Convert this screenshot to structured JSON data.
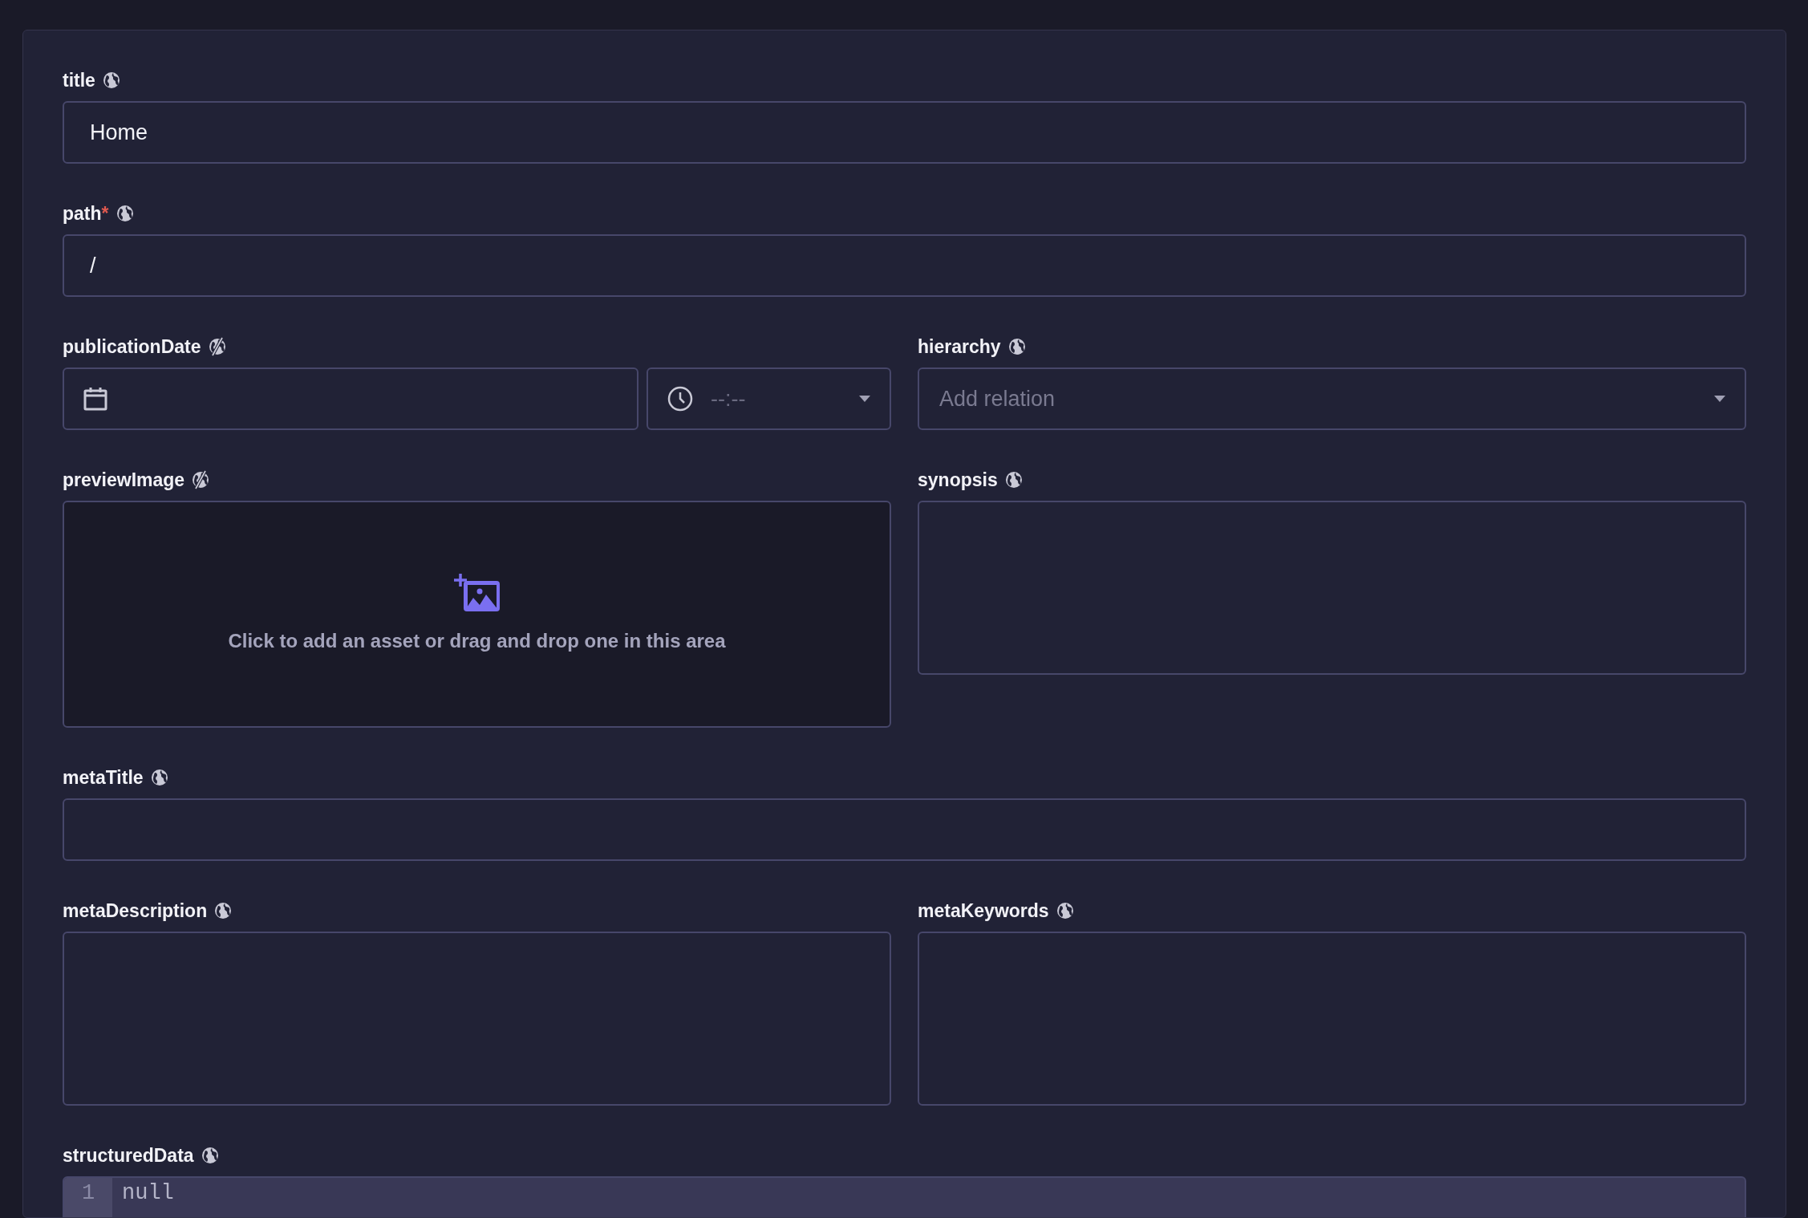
{
  "rows": [
    [
      {
        "label": "title",
        "localized": true,
        "kind": "text",
        "value": "Home"
      }
    ],
    [
      {
        "label": "path",
        "required_mark": "*",
        "localized": true,
        "kind": "text",
        "value": "/"
      }
    ],
    [
      {
        "label": "publicationDate",
        "localized": false,
        "kind": "datetime",
        "time_placeholder": "--:--"
      },
      {
        "label": "hierarchy",
        "localized": true,
        "kind": "relation",
        "placeholder": "Add relation"
      }
    ],
    [
      {
        "label": "previewImage",
        "localized": false,
        "kind": "asset",
        "hint": "Click to add an asset or drag and drop one in this area"
      },
      {
        "label": "synopsis",
        "localized": true,
        "kind": "textarea"
      }
    ],
    [
      {
        "label": "metaTitle",
        "localized": true,
        "kind": "text"
      }
    ],
    [
      {
        "label": "metaDescription",
        "localized": true,
        "kind": "textarea"
      },
      {
        "label": "metaKeywords",
        "localized": true,
        "kind": "textarea"
      }
    ],
    [
      {
        "label": "structuredData",
        "localized": true,
        "kind": "code",
        "line_number": "1",
        "code": "null"
      }
    ]
  ]
}
